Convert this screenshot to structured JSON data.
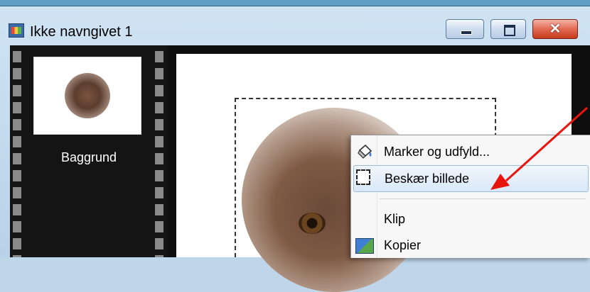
{
  "window": {
    "title": "Ikke navngivet 1",
    "controls": {
      "minimize": "minimize",
      "maximize": "maximize",
      "close": "✕"
    },
    "icon": "image-document-icon"
  },
  "filmstrip": {
    "items": [
      {
        "label": "Baggrund",
        "icon": "layer-thumbnail"
      }
    ]
  },
  "context_menu": {
    "items": [
      {
        "label": "Marker og udfyld...",
        "icon": "paint-bucket-icon"
      },
      {
        "label": "Beskær billede",
        "icon": "crop-marquee-icon",
        "highlighted": true
      },
      {
        "label": "Klip",
        "icon": ""
      },
      {
        "label": "Kopier",
        "icon": "copy-image-icon"
      }
    ]
  },
  "annotation": {
    "color": "#e8150f",
    "icon": "red-arrow"
  },
  "colors": {
    "titlebar": "#c5dcef",
    "filmstrip": "#141414",
    "close": "#d24c2e",
    "highlight": "#d9e8f8"
  }
}
